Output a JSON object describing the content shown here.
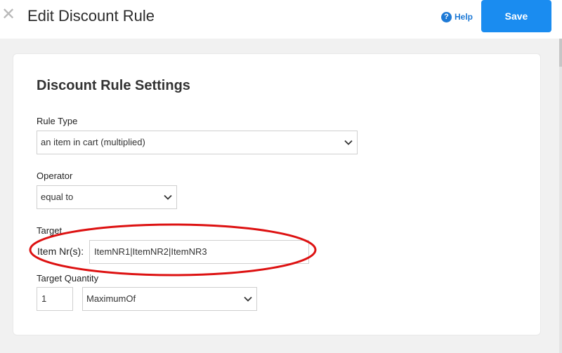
{
  "header": {
    "close_glyph": "✕",
    "title": "Edit Discount Rule",
    "help_label": "Help",
    "help_glyph": "?",
    "save_label": "Save"
  },
  "form": {
    "section_title": "Discount Rule Settings",
    "rule_type": {
      "label": "Rule Type",
      "value": "an item in cart (multiplied)"
    },
    "operator": {
      "label": "Operator",
      "value": "equal to"
    },
    "target": {
      "label": "Target",
      "item_label": "Item Nr(s):",
      "value": "ItemNR1|ItemNR2|ItemNR3"
    },
    "target_quantity": {
      "label": "Target Quantity",
      "quantity_value": "1",
      "mode_value": "MaximumOf"
    }
  },
  "colors": {
    "accent": "#1a8cf0",
    "help": "#1e7ad6",
    "annotation": "#dd1111"
  },
  "icons": {
    "close": "close-icon",
    "help": "help-icon",
    "dropdown": "chevron-down-icon"
  }
}
